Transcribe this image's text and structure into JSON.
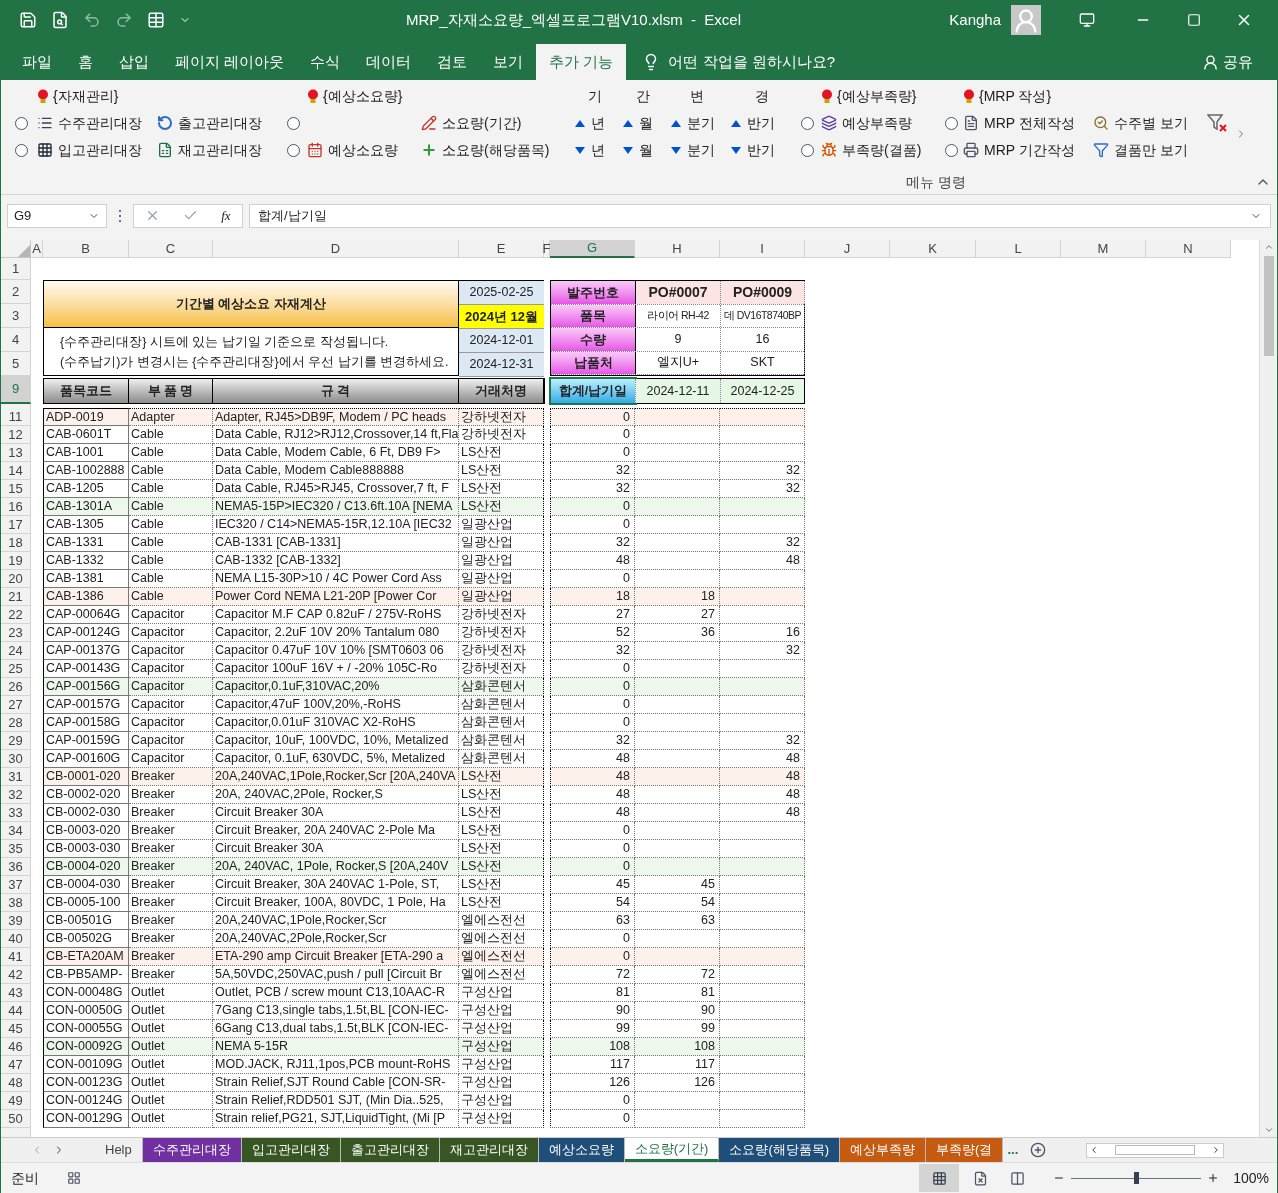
{
  "window": {
    "title": "MRP_자재소요량_엑셀프로그램V10.xlsm  -  Excel",
    "user": "Kangha"
  },
  "ribbon_tabs": [
    {
      "label": "파일",
      "selected": false
    },
    {
      "label": "홈",
      "selected": false
    },
    {
      "label": "삽입",
      "selected": false
    },
    {
      "label": "페이지 레이아웃",
      "selected": false
    },
    {
      "label": "수식",
      "selected": false
    },
    {
      "label": "데이터",
      "selected": false
    },
    {
      "label": "검토",
      "selected": false
    },
    {
      "label": "보기",
      "selected": false
    },
    {
      "label": "추가 기능",
      "selected": true
    }
  ],
  "tell_me": "어떤 작업을 원하시나요?",
  "share": "공유",
  "ribbon": {
    "headers": [
      {
        "kind": "group",
        "label": "{자재관리}"
      },
      {
        "kind": "group",
        "label": "{예상소요량}"
      },
      {
        "kind": "char",
        "label": "기"
      },
      {
        "kind": "char",
        "label": "간"
      },
      {
        "kind": "char",
        "label": "변"
      },
      {
        "kind": "char",
        "label": "경"
      },
      {
        "kind": "group",
        "label": "{예상부족량}"
      },
      {
        "kind": "group",
        "label": "{MRP 작성}"
      }
    ],
    "row_1": [
      {
        "kind": "radio",
        "selected": false
      },
      {
        "kind": "command",
        "label": "수주관리대장"
      },
      {
        "kind": "command",
        "label": "출고관리대장"
      },
      {
        "kind": "radio",
        "selected": false
      },
      {
        "kind": "command",
        "label": "소요량(기간)"
      },
      {
        "kind": "up",
        "label": "년"
      },
      {
        "kind": "up",
        "label": "월"
      },
      {
        "kind": "up",
        "label": "분기"
      },
      {
        "kind": "up",
        "label": "반기"
      },
      {
        "kind": "radio",
        "selected": false
      },
      {
        "kind": "command",
        "label": "예상부족량"
      },
      {
        "kind": "radio",
        "selected": false
      },
      {
        "kind": "command",
        "label": "MRP 전체작성"
      },
      {
        "kind": "command",
        "label": "수주별 보기"
      }
    ],
    "row_2": [
      {
        "kind": "radio",
        "selected": false
      },
      {
        "kind": "command",
        "label": "입고관리대장"
      },
      {
        "kind": "command",
        "label": "재고관리대장"
      },
      {
        "kind": "radio",
        "selected": false
      },
      {
        "kind": "command",
        "label": "예상소요량"
      },
      {
        "kind": "command",
        "label": "소요량(해당품목)"
      },
      {
        "kind": "down",
        "label": "년"
      },
      {
        "kind": "down",
        "label": "월"
      },
      {
        "kind": "down",
        "label": "분기"
      },
      {
        "kind": "down",
        "label": "반기"
      },
      {
        "kind": "radio",
        "selected": false
      },
      {
        "kind": "command",
        "label": "부족량(결품)"
      },
      {
        "kind": "radio",
        "selected": false
      },
      {
        "kind": "command",
        "label": "MRP 기간작성"
      },
      {
        "kind": "command",
        "label": "결품만 보기"
      }
    ],
    "group_label": "메뉴 명령"
  },
  "formula_bar": {
    "name_box": "G9",
    "function_label": "fx",
    "formula": "합계/납기일"
  },
  "sheet": {
    "columns": [
      {
        "label": "A",
        "selected": false
      },
      {
        "label": "B",
        "selected": false
      },
      {
        "label": "C",
        "selected": false
      },
      {
        "label": "D",
        "selected": false
      },
      {
        "label": "E",
        "selected": false
      },
      {
        "label": "F",
        "selected": false
      },
      {
        "label": "G",
        "selected": true
      },
      {
        "label": "H",
        "selected": false
      },
      {
        "label": "I",
        "selected": false
      },
      {
        "label": "J",
        "selected": false
      },
      {
        "label": "K",
        "selected": false
      },
      {
        "label": "L",
        "selected": false
      },
      {
        "label": "M",
        "selected": false
      },
      {
        "label": "N",
        "selected": false
      }
    ],
    "top_rows": [
      {
        "row": "1",
        "selected": false
      },
      {
        "row": "2",
        "selected": false
      },
      {
        "row": "3",
        "selected": false
      },
      {
        "row": "4",
        "selected": false
      },
      {
        "row": "5",
        "selected": false
      }
    ],
    "title": "기간별 예상소요 자재계산",
    "notes": [
      "{수주관리대장} 시트에 있는 납기일 기준으로 작성됩니다.",
      "(수주납기)가 변경시는 {수주관리대장}에서 우선 납기를 변경하세요."
    ],
    "dates": [
      "2025-02-25",
      "2024년 12월",
      "2024-12-01",
      "2024-12-31"
    ],
    "order_labels": [
      "발주번호",
      "품목",
      "수량",
      "납품처"
    ],
    "orders": [
      {
        "po": "PO#0007",
        "item": "라이어 RH-42",
        "qty": "9",
        "vendor": "엘지U+",
        "date": "2024-12-11"
      },
      {
        "po": "PO#0009",
        "item": "데 DV16T8740BP",
        "qty": "16",
        "vendor": "SKT",
        "date": "2024-12-25"
      }
    ],
    "header_row": {
      "row": "9",
      "selected": true,
      "labels": [
        "품목코드",
        "부 품 명",
        "규 격",
        "거래처명"
      ],
      "total_label": "합계/납기일"
    },
    "rows": [
      {
        "row": "11",
        "selected": false,
        "code": "ADP-0019",
        "part": "Adapter",
        "spec": "Adapter, RJ45>DB9F, Modem / PC heads",
        "vendor": "강하넷전자",
        "total": "0",
        "h": "",
        "i": "",
        "color": "#fdf1ec"
      },
      {
        "row": "12",
        "selected": false,
        "code": "CAB-0601T",
        "part": "Cable",
        "spec": "Data Cable, RJ12>RJ12,Crossover,14 ft,Fla",
        "vendor": "강하넷전자",
        "total": "0",
        "h": "",
        "i": ""
      },
      {
        "row": "13",
        "selected": false,
        "code": "CAB-1001",
        "part": "Cable",
        "spec": "Data Cable, Modem Cable, 6 Ft, DB9 F>",
        "vendor": "LS산전",
        "total": "0",
        "h": "",
        "i": ""
      },
      {
        "row": "14",
        "selected": false,
        "code": "CAB-1002888",
        "part": "Cable",
        "spec": "Data Cable, Modem Cable888888",
        "vendor": "LS산전",
        "total": "32",
        "h": "",
        "i": "32"
      },
      {
        "row": "15",
        "selected": false,
        "code": "CAB-1205",
        "part": "Cable",
        "spec": "Data Cable, RJ45>RJ45, Crossover,7 ft, F",
        "vendor": "LS산전",
        "total": "32",
        "h": "",
        "i": "32"
      },
      {
        "row": "16",
        "selected": false,
        "code": "CAB-1301A",
        "part": "Cable",
        "spec": "NEMA5-15P>IEC320 / C13.6ft.10A [NEMA",
        "vendor": "LS산전",
        "total": "0",
        "h": "",
        "i": "",
        "color": "#edf7ec"
      },
      {
        "row": "17",
        "selected": false,
        "code": "CAB-1305",
        "part": "Cable",
        "spec": "IEC320 / C14>NEMA5-15R,12.10A [IEC32",
        "vendor": "일광산업",
        "total": "0",
        "h": "",
        "i": ""
      },
      {
        "row": "18",
        "selected": false,
        "code": "CAB-1331",
        "part": "Cable",
        "spec": "CAB-1331 [CAB-1331]",
        "vendor": "일광산업",
        "total": "32",
        "h": "",
        "i": "32"
      },
      {
        "row": "19",
        "selected": false,
        "code": "CAB-1332",
        "part": "Cable",
        "spec": "CAB-1332 [CAB-1332]",
        "vendor": "일광산업",
        "total": "48",
        "h": "",
        "i": "48"
      },
      {
        "row": "20",
        "selected": false,
        "code": "CAB-1381",
        "part": "Cable",
        "spec": "NEMA L15-30P>10 / 4C Power Cord Ass",
        "vendor": "일광산업",
        "total": "0",
        "h": "",
        "i": ""
      },
      {
        "row": "21",
        "selected": false,
        "code": "CAB-1386",
        "part": "Cable",
        "spec": "Power Cord NEMA L21-20P [Power Cor",
        "vendor": "일광산업",
        "total": "18",
        "h": "18",
        "i": "",
        "color": "#fdf1ec"
      },
      {
        "row": "22",
        "selected": false,
        "code": "CAP-00064G",
        "part": "Capacitor",
        "spec": "Capacitor M.F CAP 0.82uF / 275V-RoHS",
        "vendor": "강하넷전자",
        "total": "27",
        "h": "27",
        "i": ""
      },
      {
        "row": "23",
        "selected": false,
        "code": "CAP-00124G",
        "part": "Capacitor",
        "spec": "Capacitor, 2.2uF 10V 20% Tantalum 080",
        "vendor": "강하넷전자",
        "total": "52",
        "h": "36",
        "i": "16"
      },
      {
        "row": "24",
        "selected": false,
        "code": "CAP-00137G",
        "part": "Capacitor",
        "spec": "Capacitor 0.47uF 10V 10% [SMT0603 06",
        "vendor": "강하넷전자",
        "total": "32",
        "h": "",
        "i": "32"
      },
      {
        "row": "25",
        "selected": false,
        "code": "CAP-00143G",
        "part": "Capacitor",
        "spec": "Capacitor 100uF 16V + / -20% 105C-Ro",
        "vendor": "강하넷전자",
        "total": "0",
        "h": "",
        "i": ""
      },
      {
        "row": "26",
        "selected": false,
        "code": "CAP-00156G",
        "part": "Capacitor",
        "spec": "Capacitor,0.1uF,310VAC,20%",
        "vendor": "삼화콘텐서",
        "total": "0",
        "h": "",
        "i": "",
        "color": "#edf7ec"
      },
      {
        "row": "27",
        "selected": false,
        "code": "CAP-00157G",
        "part": "Capacitor",
        "spec": "Capacitor,47uF 100V,20%,-RoHS",
        "vendor": "삼화콘텐서",
        "total": "0",
        "h": "",
        "i": ""
      },
      {
        "row": "28",
        "selected": false,
        "code": "CAP-00158G",
        "part": "Capacitor",
        "spec": "Capacitor,0.01uF 310VAC X2-RoHS",
        "vendor": "삼화콘텐서",
        "total": "0",
        "h": "",
        "i": ""
      },
      {
        "row": "29",
        "selected": false,
        "code": "CAP-00159G",
        "part": "Capacitor",
        "spec": "Capacitor, 10uF, 100VDC, 10%, Metalized",
        "vendor": "삼화콘텐서",
        "total": "32",
        "h": "",
        "i": "32"
      },
      {
        "row": "30",
        "selected": false,
        "code": "CAP-00160G",
        "part": "Capacitor",
        "spec": "Capacitor, 0.1uF, 630VDC, 5%, Metalized",
        "vendor": "삼화콘텐서",
        "total": "48",
        "h": "",
        "i": "48"
      },
      {
        "row": "31",
        "selected": false,
        "code": "CB-0001-020",
        "part": "Breaker",
        "spec": "20A,240VAC,1Pole,Rocker,Scr [20A,240VA",
        "vendor": "LS산전",
        "total": "48",
        "h": "",
        "i": "48",
        "color": "#fdf1ec"
      },
      {
        "row": "32",
        "selected": false,
        "code": "CB-0002-020",
        "part": "Breaker",
        "spec": "20A, 240VAC,2Pole, Rocker,S",
        "vendor": "LS산전",
        "total": "48",
        "h": "",
        "i": "48"
      },
      {
        "row": "33",
        "selected": false,
        "code": "CB-0002-030",
        "part": "Breaker",
        "spec": "Circuit Breaker 30A",
        "vendor": "LS산전",
        "total": "48",
        "h": "",
        "i": "48"
      },
      {
        "row": "34",
        "selected": false,
        "code": "CB-0003-020",
        "part": "Breaker",
        "spec": "Circuit Breaker, 20A 240VAC 2-Pole Ma",
        "vendor": "LS산전",
        "total": "0",
        "h": "",
        "i": ""
      },
      {
        "row": "35",
        "selected": false,
        "code": "CB-0003-030",
        "part": "Breaker",
        "spec": "Circuit Breaker 30A",
        "vendor": "LS산전",
        "total": "0",
        "h": "",
        "i": ""
      },
      {
        "row": "36",
        "selected": false,
        "code": "CB-0004-020",
        "part": "Breaker",
        "spec": "20A, 240VAC, 1Pole, Rocker,S [20A,240V",
        "vendor": "LS산전",
        "total": "0",
        "h": "",
        "i": "",
        "color": "#edf7ec"
      },
      {
        "row": "37",
        "selected": false,
        "code": "CB-0004-030",
        "part": "Breaker",
        "spec": "Circuit Breaker, 30A 240VAC 1-Pole, ST,",
        "vendor": "LS산전",
        "total": "45",
        "h": "45",
        "i": ""
      },
      {
        "row": "38",
        "selected": false,
        "code": "CB-0005-100",
        "part": "Breaker",
        "spec": "Circuit Breaker, 100A, 80VDC, 1 Pole, Ha",
        "vendor": "LS산전",
        "total": "54",
        "h": "54",
        "i": ""
      },
      {
        "row": "39",
        "selected": false,
        "code": "CB-00501G",
        "part": "Breaker",
        "spec": "20A,240VAC,1Pole,Rocker,Scr",
        "vendor": "엘에스전선",
        "total": "63",
        "h": "63",
        "i": ""
      },
      {
        "row": "40",
        "selected": false,
        "code": "CB-00502G",
        "part": "Breaker",
        "spec": "20A,240VAC,2Pole,Rocker,Scr",
        "vendor": "엘에스전선",
        "total": "0",
        "h": "",
        "i": ""
      },
      {
        "row": "41",
        "selected": false,
        "code": "CB-ETA20AM",
        "part": "Breaker",
        "spec": "ETA-290 amp Circuit Breaker [ETA-290 a",
        "vendor": "엘에스전선",
        "total": "0",
        "h": "",
        "i": "",
        "color": "#fdf1ec"
      },
      {
        "row": "42",
        "selected": false,
        "code": "CB-PB5AMP-",
        "part": "Breaker",
        "spec": "5A,50VDC,250VAC,push / pull [Circuit Br",
        "vendor": "엘에스전선",
        "total": "72",
        "h": "72",
        "i": ""
      },
      {
        "row": "43",
        "selected": false,
        "code": "CON-00048G",
        "part": "Outlet",
        "spec": "Outlet, PCB / screw mount C13,10AAC-R",
        "vendor": "구성산업",
        "total": "81",
        "h": "81",
        "i": ""
      },
      {
        "row": "44",
        "selected": false,
        "code": "CON-00050G",
        "part": "Outlet",
        "spec": "7Gang C13,single tabs,1.5t,BL [CON-IEC-",
        "vendor": "구성산업",
        "total": "90",
        "h": "90",
        "i": ""
      },
      {
        "row": "45",
        "selected": false,
        "code": "CON-00055G",
        "part": "Outlet",
        "spec": "6Gang C13,dual tabs,1.5t,BLK [CON-IEC-",
        "vendor": "구성산업",
        "total": "99",
        "h": "99",
        "i": ""
      },
      {
        "row": "46",
        "selected": false,
        "code": "CON-00092G",
        "part": "Outlet",
        "spec": "NEMA 5-15R",
        "vendor": "구성산업",
        "total": "108",
        "h": "108",
        "i": "",
        "color": "#edf7ec"
      },
      {
        "row": "47",
        "selected": false,
        "code": "CON-00109G",
        "part": "Outlet",
        "spec": "MOD.JACK, RJ11,1pos,PCB mount-RoHS",
        "vendor": "구성산업",
        "total": "117",
        "h": "117",
        "i": ""
      },
      {
        "row": "48",
        "selected": false,
        "code": "CON-00123G",
        "part": "Outlet",
        "spec": "Strain Relief,SJT Round Cable [CON-SR-",
        "vendor": "구성산업",
        "total": "126",
        "h": "126",
        "i": ""
      },
      {
        "row": "49",
        "selected": false,
        "code": "CON-00124G",
        "part": "Outlet",
        "spec": "Strain Relief,RDD501 SJT, (Min Dia..525,",
        "vendor": "구성산업",
        "total": "0",
        "h": "",
        "i": ""
      },
      {
        "row": "50",
        "selected": false,
        "code": "CON-00129G",
        "part": "Outlet",
        "spec": "Strain relief,PG21, SJT,LiquidTight, (Mi [P",
        "vendor": "구성산업",
        "total": "0",
        "h": "",
        "i": ""
      }
    ]
  },
  "sheet_tabs": [
    {
      "label": "Help",
      "selected": false
    },
    {
      "label": "수주관리대장",
      "selected": false,
      "color": "#7030a0"
    },
    {
      "label": "입고관리대장",
      "selected": false,
      "color": "#375623"
    },
    {
      "label": "출고관리대장",
      "selected": false,
      "color": "#375623"
    },
    {
      "label": "재고관리대장",
      "selected": false,
      "color": "#375623"
    },
    {
      "label": "예상소요량",
      "selected": false,
      "color": "#1f4e79"
    },
    {
      "label": "소요량(기간)",
      "selected": true
    },
    {
      "label": "소요량(해당품목)",
      "selected": false,
      "color": "#1f4e79"
    },
    {
      "label": "예상부족량",
      "selected": false,
      "color": "#c55a11"
    },
    {
      "label": "부족량(결",
      "selected": false,
      "color": "#c55a11"
    }
  ],
  "more_tabs": "...",
  "status_bar": {
    "status": "준비",
    "zoom": {
      "level": 0.5,
      "reading": "100%"
    }
  }
}
